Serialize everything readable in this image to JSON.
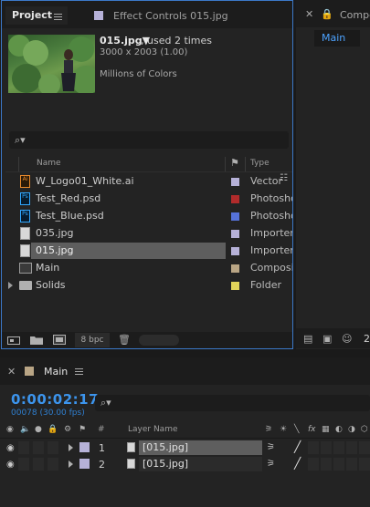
{
  "project_panel": {
    "tab_label": "Project",
    "effect_controls_tab": "Effect Controls 015.jpg",
    "selected_item": {
      "name": "015.jpg▼",
      "used": ", used 2 times",
      "dimensions": "3000 x 2003 (1.00)",
      "colors": "Millions of Colors"
    },
    "search_icon": "⌕▾",
    "columns": {
      "name": "Name",
      "type": "Type"
    },
    "items": [
      {
        "name": "W_Logo01_White.ai",
        "type": "Vector",
        "icon": "ai",
        "label_color": "#b6b1d8"
      },
      {
        "name": "Test_Red.psd",
        "type": "Photoshop",
        "icon": "ps",
        "label_color": "#b12b2b"
      },
      {
        "name": "Test_Blue.psd",
        "type": "Photoshop",
        "icon": "ps",
        "label_color": "#5672d8"
      },
      {
        "name": "035.jpg",
        "type": "Importer",
        "icon": "image",
        "label_color": "#b6b1d8"
      },
      {
        "name": "015.jpg",
        "type": "Importer",
        "icon": "image",
        "label_color": "#b6b1d8"
      },
      {
        "name": "Main",
        "type": "Composition",
        "icon": "composition",
        "label_color": "#b9a585"
      },
      {
        "name": "Solids",
        "type": "Folder",
        "icon": "folder",
        "label_color": "#e2d45a"
      }
    ],
    "bpc": "8 bpc"
  },
  "right_panel": {
    "tab_label": "Compo",
    "viewer_tab": "Main",
    "zoom": "2"
  },
  "timeline": {
    "tab_label": "Main",
    "timecode": "0:00:02:17",
    "frames": "00078 (30.00 fps)",
    "search_icon": "⌕▾",
    "col_hash": "#",
    "col_layer_name": "Layer Name",
    "layers": [
      {
        "num": "1",
        "name": "[015.jpg]",
        "color": "#b6b1d8"
      },
      {
        "num": "2",
        "name": "[015.jpg]",
        "color": "#b6b1d8"
      }
    ]
  },
  "colors": {
    "accent_blue": "#3c94ec",
    "panel_bg": "#232323",
    "selection": "#5e5e5e"
  }
}
